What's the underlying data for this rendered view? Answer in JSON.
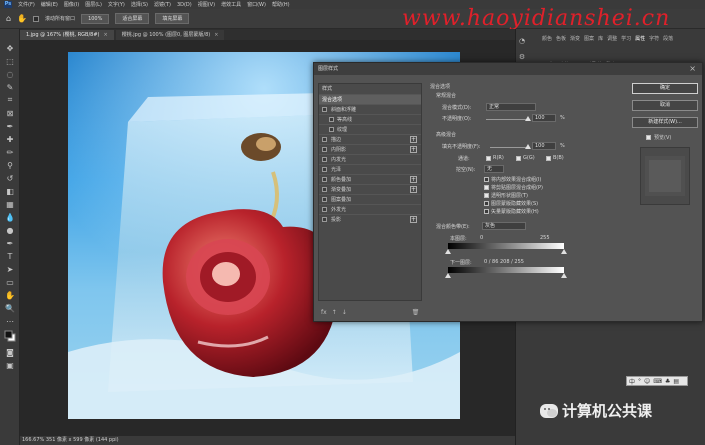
{
  "menu": {
    "logo": "Ps",
    "items": [
      "文件(F)",
      "编辑(E)",
      "图像(I)",
      "图层(L)",
      "文字(Y)",
      "选择(S)",
      "滤镜(T)",
      "3D(D)",
      "视图(V)",
      "增效工具",
      "窗口(W)",
      "帮助(H)"
    ]
  },
  "options": {
    "scroll_all_label": "滚动所有窗口",
    "zoom_value": "100%",
    "fit_screen_label": "适合屏幕",
    "fill_screen_label": "填充屏幕"
  },
  "watermark": "www.haoyidianshei.cn",
  "tabs": [
    {
      "label": "1.jpg @ 167% (樱桃, RGB/8#)",
      "close": "×",
      "active": true
    },
    {
      "label": "樱桃.jpg @ 100% (图层0, 图层蒙版/8)",
      "close": "×",
      "active": false
    }
  ],
  "status": {
    "text": "166.67%   351 像素 x 599 像素 (144 ppi)"
  },
  "right_panel": {
    "tabs": [
      "颜色",
      "色板",
      "渐变",
      "图案",
      "库",
      "调整",
      "学习",
      "属性",
      "字符",
      "段落",
      "历史",
      "动作",
      "图层",
      "通道",
      "路径"
    ]
  },
  "dialog": {
    "title": "图层样式",
    "close": "×",
    "styles_header": "样式",
    "style_items": [
      {
        "label": "混合选项",
        "selected": true,
        "has_plus": false,
        "sub": false
      },
      {
        "label": "斜面和浮雕",
        "selected": false,
        "has_plus": false,
        "sub": false
      },
      {
        "label": "等高线",
        "selected": false,
        "has_plus": false,
        "sub": true
      },
      {
        "label": "纹理",
        "selected": false,
        "has_plus": false,
        "sub": true
      },
      {
        "label": "描边",
        "selected": false,
        "has_plus": true,
        "sub": false
      },
      {
        "label": "内阴影",
        "selected": false,
        "has_plus": true,
        "sub": false
      },
      {
        "label": "内发光",
        "selected": false,
        "has_plus": false,
        "sub": false
      },
      {
        "label": "光泽",
        "selected": false,
        "has_plus": false,
        "sub": false
      },
      {
        "label": "颜色叠加",
        "selected": false,
        "has_plus": true,
        "sub": false
      },
      {
        "label": "渐变叠加",
        "selected": false,
        "has_plus": true,
        "sub": false
      },
      {
        "label": "图案叠加",
        "selected": false,
        "has_plus": false,
        "sub": false
      },
      {
        "label": "外发光",
        "selected": false,
        "has_plus": false,
        "sub": false
      },
      {
        "label": "投影",
        "selected": false,
        "has_plus": true,
        "sub": false
      }
    ],
    "footer_icons": [
      "fx",
      "↑",
      "↓",
      "🗑"
    ],
    "blend": {
      "section_title": "混合选项",
      "general_title": "常规混合",
      "mode_label": "混合模式(D):",
      "mode_value": "正常",
      "opacity_label": "不透明度(O):",
      "opacity_value": "100",
      "opacity_unit": "%",
      "advanced_title": "高级混合",
      "fill_opacity_label": "填充不透明度(F):",
      "fill_opacity_value": "100",
      "fill_unit": "%",
      "channels_label": "通道:",
      "channel_r": "R(R)",
      "channel_g": "G(G)",
      "channel_b": "B(B)",
      "knockout_label": "挖空(N):",
      "knockout_value": "无",
      "opt1": "将内部效果混合成组(I)",
      "opt2": "将剪贴图层混合成组(P)",
      "opt3": "透明形状图层(T)",
      "opt4": "图层蒙版隐藏效果(S)",
      "opt5": "矢量蒙版隐藏效果(H)",
      "blend_if_label": "混合颜色带(E):",
      "blend_if_value": "灰色",
      "this_layer_label": "本图层:",
      "this_layer_lo": "0",
      "this_layer_hi": "255",
      "under_layer_label": "下一图层:",
      "under_layer_vals": "0    /    86    208    /    255"
    },
    "buttons": {
      "ok": "确定",
      "cancel": "取消",
      "new_style": "新建样式(W)...",
      "preview_label": "预览(V)"
    }
  },
  "branding": {
    "wechat_text": "计算机公共课"
  },
  "mini_toolbar": {
    "icons": [
      "中",
      "°",
      "☺",
      "⌨",
      "♣",
      "▤"
    ]
  }
}
